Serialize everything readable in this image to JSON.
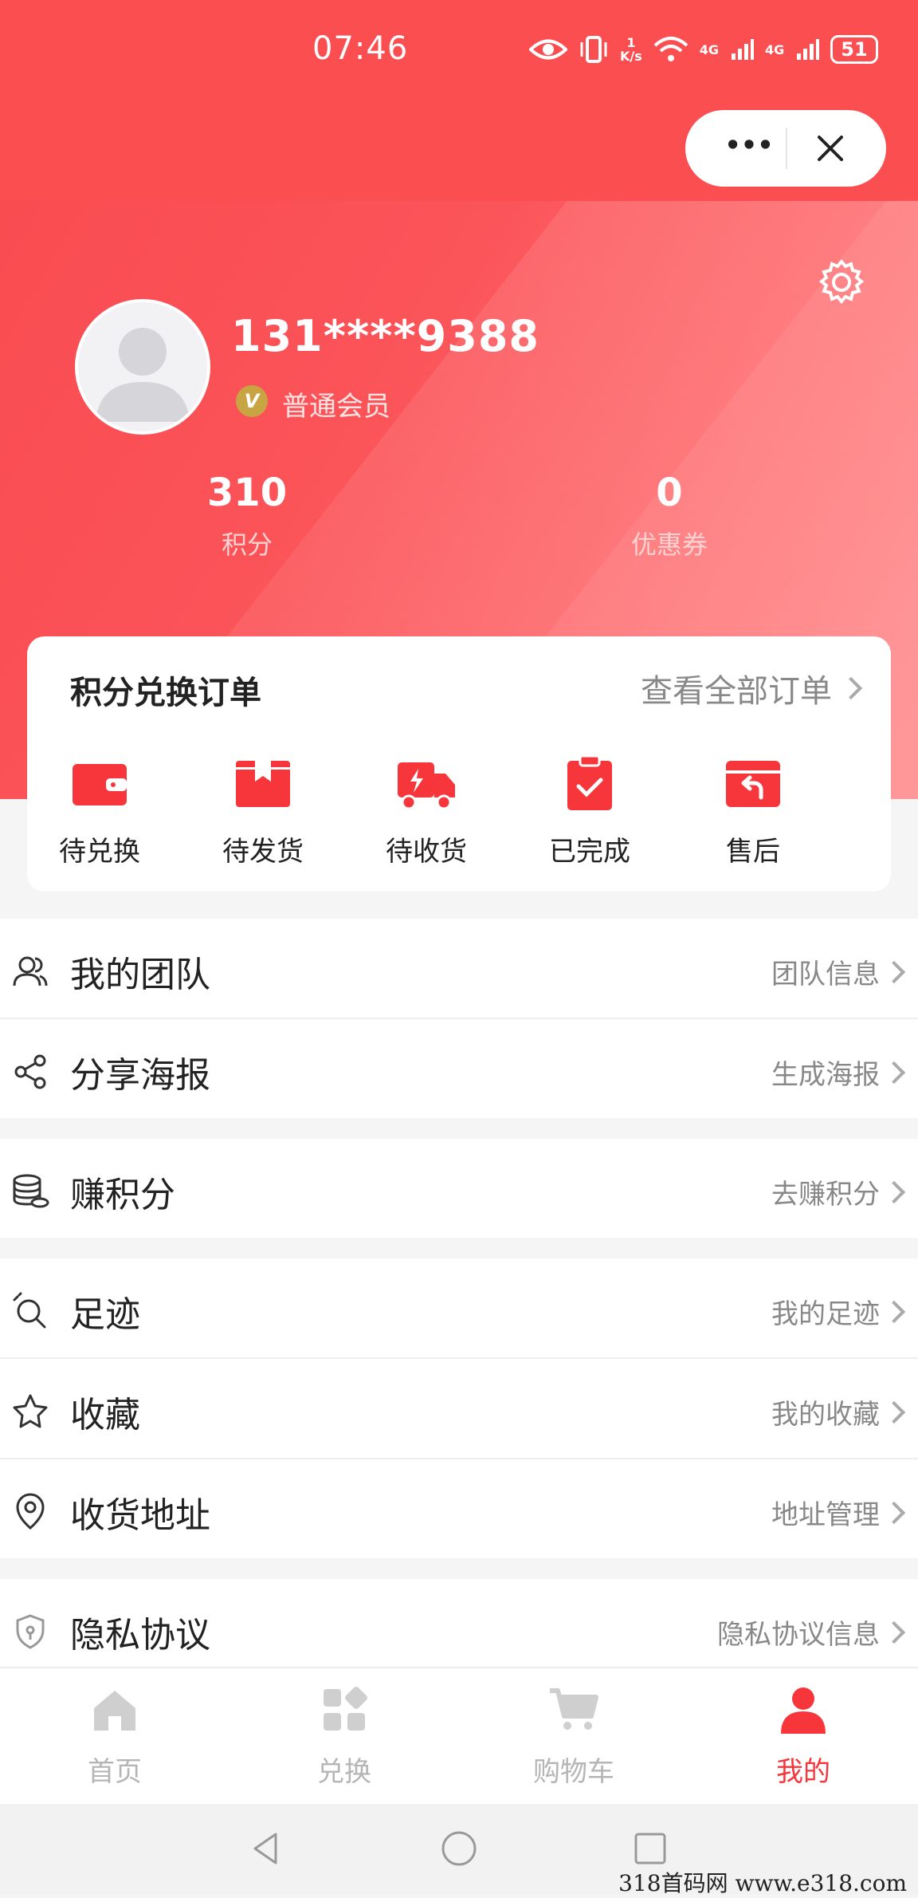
{
  "status_bar": {
    "time": "07:46",
    "net_speed_value": "1",
    "net_speed_unit": "K/s",
    "signal1": "4G",
    "signal2": "4G",
    "battery": "51"
  },
  "capsule": {
    "more": "•••"
  },
  "profile": {
    "phone": "131****9388",
    "level_badge": "V",
    "level": "普通会员"
  },
  "stats": [
    {
      "value": "310",
      "label": "积分"
    },
    {
      "value": "0",
      "label": "优惠券"
    }
  ],
  "orders": {
    "title": "积分兑换订单",
    "view_all": "查看全部订单",
    "items": [
      {
        "label": "待兑换",
        "icon": "wallet-icon"
      },
      {
        "label": "待发货",
        "icon": "box-icon"
      },
      {
        "label": "待收货",
        "icon": "truck-icon"
      },
      {
        "label": "已完成",
        "icon": "clipboard-check-icon"
      },
      {
        "label": "售后",
        "icon": "return-icon"
      }
    ]
  },
  "menu": [
    {
      "title": "我的团队",
      "right": "团队信息",
      "icon": "team-icon"
    },
    {
      "title": "分享海报",
      "right": "生成海报",
      "icon": "share-icon"
    },
    {
      "title": "赚积分",
      "right": "去赚积分",
      "icon": "coins-icon"
    },
    {
      "title": "足迹",
      "right": "我的足迹",
      "icon": "footprint-icon"
    },
    {
      "title": "收藏",
      "right": "我的收藏",
      "icon": "star-icon"
    },
    {
      "title": "收货地址",
      "right": "地址管理",
      "icon": "location-icon"
    },
    {
      "title": "隐私协议",
      "right": "隐私协议信息",
      "icon": "shield-icon"
    }
  ],
  "tabs": [
    {
      "label": "首页",
      "icon": "home-icon"
    },
    {
      "label": "兑换",
      "icon": "grid-icon"
    },
    {
      "label": "购物车",
      "icon": "cart-icon"
    },
    {
      "label": "我的",
      "icon": "user-icon"
    }
  ],
  "colors": {
    "brand": "#fb4e51",
    "active_tab": "#f7363c"
  },
  "watermark": "318首码网  www.e318.com"
}
